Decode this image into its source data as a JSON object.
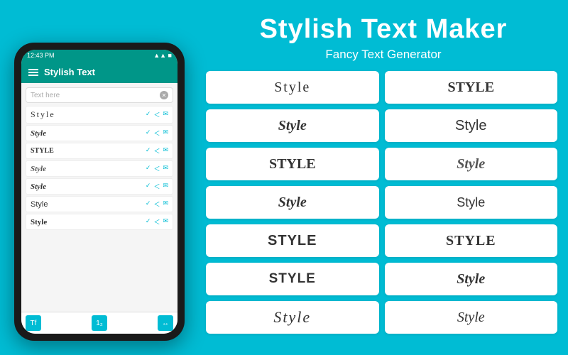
{
  "header": {
    "title": "Stylish Text Maker",
    "subtitle": "Fancy Text Generator"
  },
  "phone": {
    "status_time": "12:43 PM",
    "status_signal": "▲▲▲",
    "status_battery": "■■■",
    "toolbar_title": "Stylish Text",
    "search_placeholder": "Text here",
    "list_items": [
      {
        "text": "Style",
        "style": "serif-normal"
      },
      {
        "text": "Style",
        "style": "italic"
      },
      {
        "text": "STYLE",
        "style": "bold-caps"
      },
      {
        "text": "Style",
        "style": "script"
      },
      {
        "text": "Style",
        "style": "handwriting"
      },
      {
        "text": "Style",
        "style": "serif-light"
      },
      {
        "text": "Style",
        "style": "bold-sans"
      }
    ],
    "bottom_icons": [
      "Tf",
      "123",
      "<->"
    ]
  },
  "grid": {
    "cards": [
      {
        "text": "Style",
        "style": "thin"
      },
      {
        "text": "STYLE",
        "style": "bold-serif"
      },
      {
        "text": "Style",
        "style": "italic-serif"
      },
      {
        "text": "Style",
        "style": "normal"
      },
      {
        "text": "STYLE",
        "style": "small-caps"
      },
      {
        "text": "Style",
        "style": "script"
      },
      {
        "text": "Style",
        "style": "handwriting"
      },
      {
        "text": "Style",
        "style": "italic-thin"
      },
      {
        "text": "Style",
        "style": "gothic"
      },
      {
        "text": "STYLE",
        "style": "blackletter"
      },
      {
        "text": "STYLE",
        "style": "bold-outline"
      },
      {
        "text": "Style",
        "style": "cursive-bold"
      },
      {
        "text": "Style",
        "style": "elegant"
      },
      {
        "text": "Style",
        "style": "serif-light"
      }
    ]
  }
}
